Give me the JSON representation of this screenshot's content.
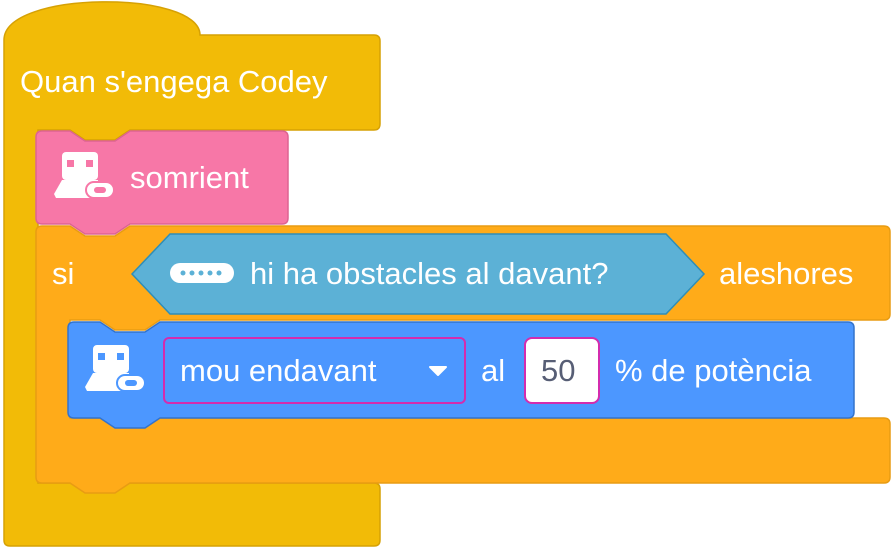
{
  "colors": {
    "events": "#f2bb07",
    "looks": "#f777a7",
    "control": "#ffab19",
    "sensor": "#5cb1d6",
    "motion": "#4c97ff",
    "field_border": "#d42cae"
  },
  "hat": {
    "label": "Quan s'engega Codey"
  },
  "face_block": {
    "icon": "codey-robot-icon",
    "label": "somrient"
  },
  "if_block": {
    "if_label": "si",
    "then_label": "aleshores",
    "condition": {
      "icon": "ultrasonic-sensor-icon",
      "label": "hi ha obstacles al davant?"
    }
  },
  "move_block": {
    "icon": "codey-robot-icon",
    "direction": "mou endavant",
    "at_label": "al",
    "power": "50",
    "unit_label": "% de potència"
  }
}
